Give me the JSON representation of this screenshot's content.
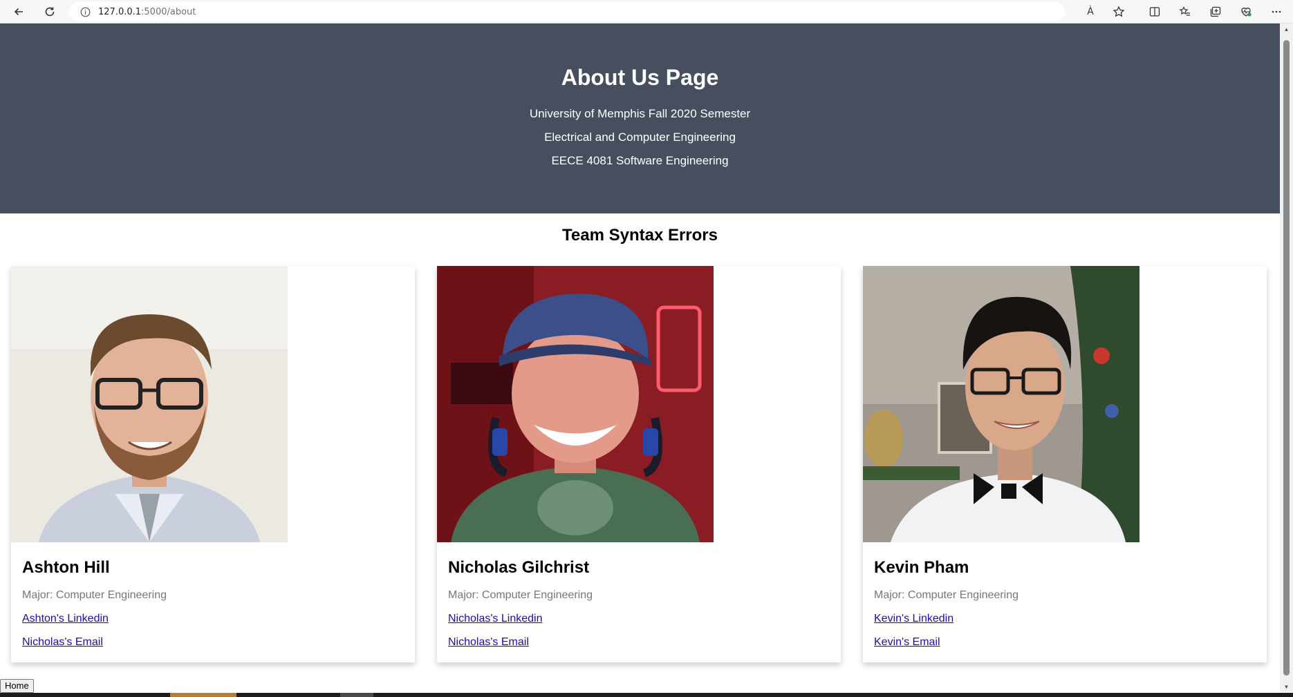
{
  "browser": {
    "url_host": "127.0.0.1",
    "url_path": ":5000/about",
    "read_aloud_glyph": "À"
  },
  "hero": {
    "title": "About Us Page",
    "lines": [
      "University of Memphis Fall 2020 Semester",
      "Electrical and Computer Engineering",
      "EECE 4081 Software Engineering"
    ]
  },
  "team": {
    "title": "Team Syntax Errors",
    "members": [
      {
        "name": "Ashton Hill",
        "major": "Major: Computer Engineering",
        "link_1": "Ashton's Linkedin",
        "link_2": "Nicholas's Email"
      },
      {
        "name": "Nicholas Gilchrist",
        "major": "Major: Computer Engineering",
        "link_1": "Nicholas's Linkedin",
        "link_2": "Nicholas's Email"
      },
      {
        "name": "Kevin Pham",
        "major": "Major: Computer Engineering",
        "link_1": "Kevin's Linkedin",
        "link_2": "Kevin's Email"
      }
    ]
  },
  "footer": {
    "home_label": "Home"
  },
  "colors": {
    "hero_bg": "#474f5e",
    "link": "#1a0dab",
    "muted_text": "#777777"
  }
}
